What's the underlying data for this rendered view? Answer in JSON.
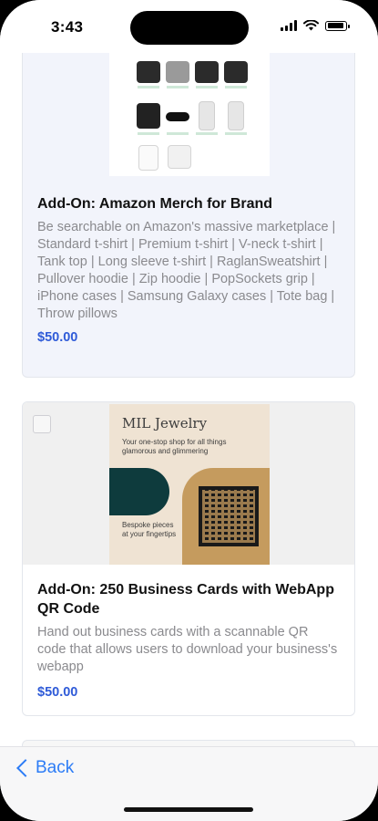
{
  "status_bar": {
    "time": "3:43"
  },
  "products": [
    {
      "title": "Add-On: Amazon Merch for Brand",
      "description": "Be searchable on Amazon's massive marketplace | Standard t-shirt | Premium t-shirt | V-neck t-shirt | Tank top | Long sleeve t-shirt | RaglanSweatshirt | Pullover hoodie | Zip hoodie | PopSockets grip | iPhone cases | Samsung Galaxy cases | Tote bag | Throw pillows",
      "price": "$50.00"
    },
    {
      "title": "Add-On: 250 Business Cards with WebApp QR Code",
      "description": "Hand out business cards with a scannable QR code that allows users to download your business's webapp",
      "price": "$50.00",
      "image": {
        "brand": "MIL Jewelry",
        "tagline": "Your one-stop shop for all things glamorous and glimmering",
        "text": "Bespoke pieces at your fingertips"
      }
    }
  ],
  "nav": {
    "back_label": "Back"
  },
  "colors": {
    "accent": "#2c7cf6",
    "price": "#2f5bd8"
  }
}
